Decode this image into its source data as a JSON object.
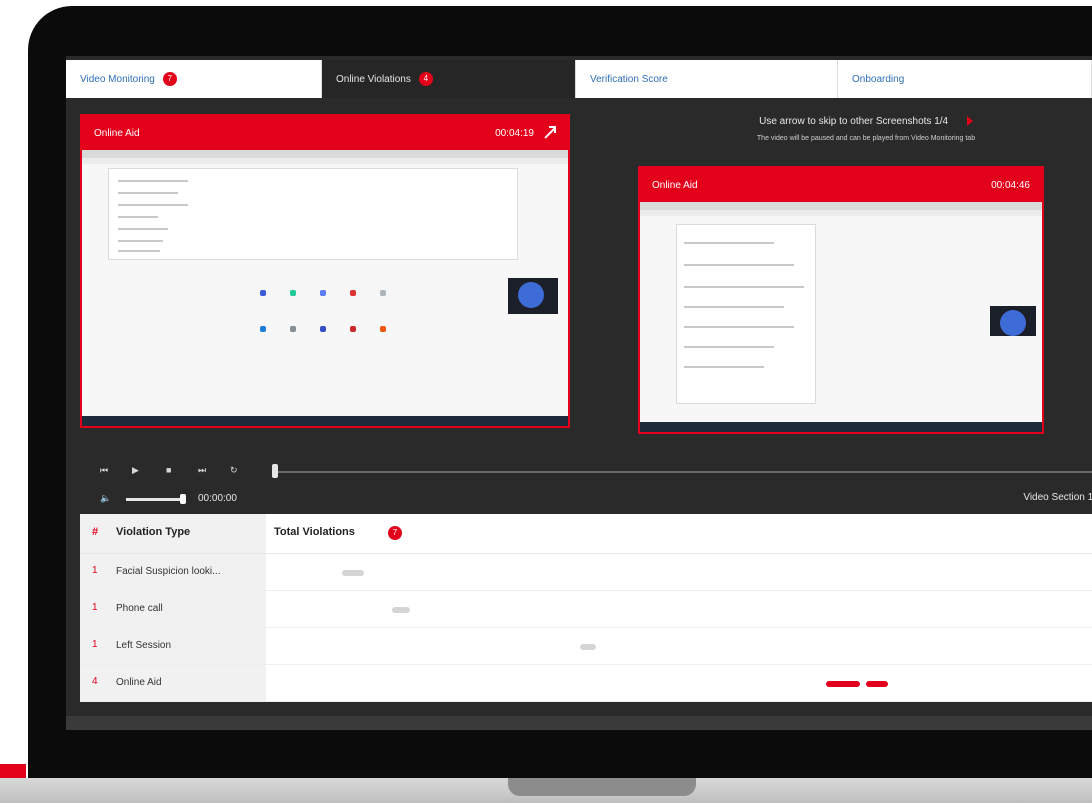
{
  "tabs": [
    {
      "label": "Video Monitoring",
      "badge": "7"
    },
    {
      "label": "Online Violations",
      "badge": "4"
    },
    {
      "label": "Verification Score",
      "badge": ""
    },
    {
      "label": "Onboarding",
      "badge": ""
    }
  ],
  "left_panel": {
    "title": "Online Aid",
    "time": "00:04:19"
  },
  "hint": {
    "line1": "Use arrow to skip to other Screenshots 1/4",
    "line2": "The video will be paused and can be played from Video Monitoring tab"
  },
  "right_panel": {
    "title": "Online Aid",
    "time": "00:04:46"
  },
  "player": {
    "time": "00:00:00",
    "section": "Video Section 1/"
  },
  "table": {
    "header_num": "#",
    "col_type": "Violation Type",
    "col_total": "Total Violations",
    "total_badge": "7",
    "rows": [
      {
        "n": "1",
        "label": "Facial Suspicion looki..."
      },
      {
        "n": "1",
        "label": "Phone call"
      },
      {
        "n": "1",
        "label": "Left Session"
      },
      {
        "n": "4",
        "label": "Online Aid"
      }
    ]
  },
  "colors": {
    "accent": "#e3001b",
    "link": "#2f6fb7",
    "dark": "#2a2a2a"
  }
}
